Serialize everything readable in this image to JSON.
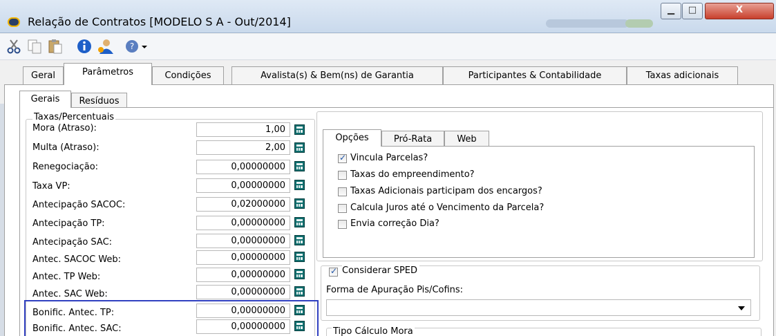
{
  "window": {
    "title": "Relação de Contratos [MODELO S A - Out/2014]",
    "buttons": {
      "minimize": "▁",
      "maximize": "□",
      "close": "X"
    }
  },
  "toolbar": {
    "icons": [
      "cut-icon",
      "copy-icon",
      "paste-icon",
      "info-icon",
      "user-icon",
      "help-icon",
      "dropdown-arrow-icon"
    ]
  },
  "tabs": [
    "Geral",
    "Parâmetros",
    "Condições",
    "Avalista(s) & Bem(ns) de Garantia",
    "Participantes & Contabilidade",
    "Taxas adicionais"
  ],
  "active_tab": "Parâmetros",
  "subtabs": [
    "Gerais",
    "Resíduos"
  ],
  "active_subtab": "Gerais",
  "taxas": {
    "group_title": "Taxas/Percentuais",
    "rows": [
      {
        "label": "Mora (Atraso):",
        "value": "1,00"
      },
      {
        "label": "Multa (Atraso):",
        "value": "2,00"
      },
      {
        "label": "Renegociação:",
        "value": "0,00000000"
      },
      {
        "label": "Taxa VP:",
        "value": "0,00000000"
      },
      {
        "label": "Antecipação SACOC:",
        "value": "0,02000000"
      },
      {
        "label": "Antecipação TP:",
        "value": "0,00000000"
      },
      {
        "label": "Antecipação SAC:",
        "value": "0,00000000"
      },
      {
        "label": "Antec. SACOC Web:",
        "value": "0,00000000"
      },
      {
        "label": "Antec. TP Web:",
        "value": "0,00000000"
      },
      {
        "label": "Antec. SAC Web:",
        "value": "0,00000000"
      },
      {
        "label": "Bonific. Antec. TP:",
        "value": "0,00000000"
      },
      {
        "label": "Bonific. Antec. SAC:",
        "value": "0,00000000"
      }
    ]
  },
  "opcoes": {
    "tabs": [
      "Opções",
      "Pró-Rata",
      "Web"
    ],
    "active": "Opções",
    "checkboxes": [
      {
        "label": "Vincula Parcelas?",
        "checked": true
      },
      {
        "label": "Taxas do empreendimento?",
        "checked": false
      },
      {
        "label": "Taxas Adicionais participam dos encargos?",
        "checked": false
      },
      {
        "label": "Calcula Juros até o Vencimento da Parcela?",
        "checked": false
      },
      {
        "label": "Envia correção Dia?",
        "checked": false
      }
    ]
  },
  "sped": {
    "label": "Considerar SPED",
    "checked": true,
    "forma_label": "Forma de Apuração Pis/Cofins:",
    "forma_value": ""
  },
  "mora": {
    "title": "Tipo Cálculo Mora"
  },
  "colors": {
    "highlight": "#3040c0",
    "titlebar": "#c9d9ec",
    "calc_icon": "#0f6f6f"
  }
}
